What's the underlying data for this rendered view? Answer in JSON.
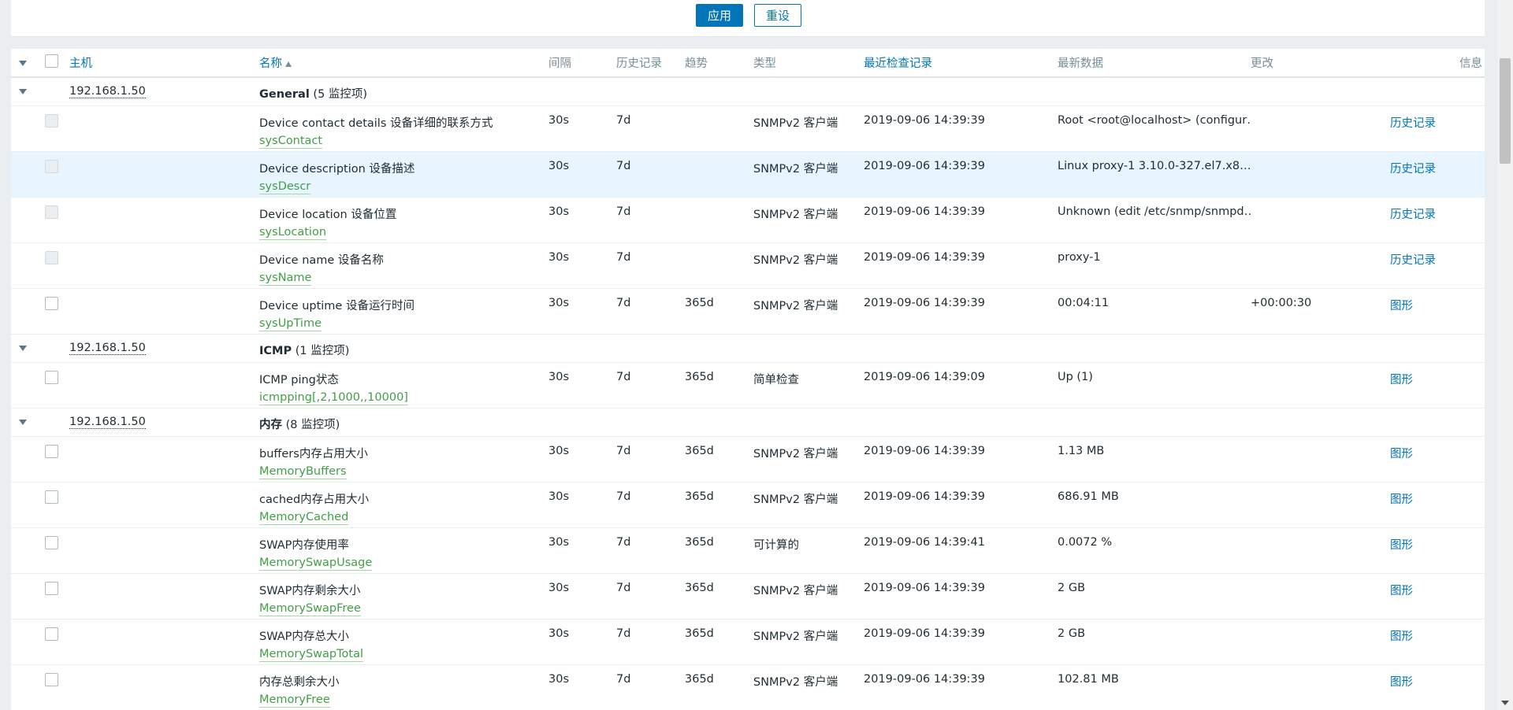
{
  "filter": {
    "apply_label": "应用",
    "reset_label": "重设"
  },
  "table": {
    "headers": {
      "host": "主机",
      "name": "名称",
      "interval": "间隔",
      "history": "历史记录",
      "trends": "趋势",
      "type": "类型",
      "last_check": "最近检查记录",
      "last_value": "最新数据",
      "change": "更改",
      "info": "信息"
    },
    "groups": [
      {
        "host": "192.168.1.50",
        "name": "General",
        "count": "(5 监控项)",
        "items": [
          {
            "name": "Device contact details 设备详细的联系方式",
            "key": "sysContact",
            "interval": "30s",
            "history": "7d",
            "trends": "",
            "type": "SNMPv2 客户端",
            "last_check": "2019-09-06 14:39:39",
            "last_value": "Root <root@localhost> (configur…",
            "change": "",
            "action": "历史记录",
            "disabled": true,
            "highlight": false
          },
          {
            "name": "Device description 设备描述",
            "key": "sysDescr",
            "interval": "30s",
            "history": "7d",
            "trends": "",
            "type": "SNMPv2 客户端",
            "last_check": "2019-09-06 14:39:39",
            "last_value": "Linux proxy-1 3.10.0-327.el7.x8…",
            "change": "",
            "action": "历史记录",
            "disabled": true,
            "highlight": true
          },
          {
            "name": "Device location 设备位置",
            "key": "sysLocation",
            "interval": "30s",
            "history": "7d",
            "trends": "",
            "type": "SNMPv2 客户端",
            "last_check": "2019-09-06 14:39:39",
            "last_value": "Unknown (edit /etc/snmp/snmpd…",
            "change": "",
            "action": "历史记录",
            "disabled": true,
            "highlight": false
          },
          {
            "name": "Device name 设备名称",
            "key": "sysName",
            "interval": "30s",
            "history": "7d",
            "trends": "",
            "type": "SNMPv2 客户端",
            "last_check": "2019-09-06 14:39:39",
            "last_value": "proxy-1",
            "change": "",
            "action": "历史记录",
            "disabled": true,
            "highlight": false
          },
          {
            "name": "Device uptime 设备运行时间",
            "key": "sysUpTime",
            "interval": "30s",
            "history": "7d",
            "trends": "365d",
            "type": "SNMPv2 客户端",
            "last_check": "2019-09-06 14:39:39",
            "last_value": "00:04:11",
            "change": "+00:00:30",
            "action": "图形",
            "disabled": false,
            "highlight": false
          }
        ]
      },
      {
        "host": "192.168.1.50",
        "name": "ICMP",
        "count": "(1 监控项)",
        "items": [
          {
            "name": "ICMP ping状态",
            "key": "icmpping[,2,1000,,10000]",
            "interval": "30s",
            "history": "7d",
            "trends": "365d",
            "type": "简单检查",
            "last_check": "2019-09-06 14:39:09",
            "last_value": "Up (1)",
            "change": "",
            "action": "图形",
            "disabled": false,
            "highlight": false
          }
        ]
      },
      {
        "host": "192.168.1.50",
        "name": "内存",
        "count": "(8 监控项)",
        "items": [
          {
            "name": "buffers内存占用大小",
            "key": "MemoryBuffers",
            "interval": "30s",
            "history": "7d",
            "trends": "365d",
            "type": "SNMPv2 客户端",
            "last_check": "2019-09-06 14:39:39",
            "last_value": "1.13 MB",
            "change": "",
            "action": "图形",
            "disabled": false,
            "highlight": false
          },
          {
            "name": "cached内存占用大小",
            "key": "MemoryCached",
            "interval": "30s",
            "history": "7d",
            "trends": "365d",
            "type": "SNMPv2 客户端",
            "last_check": "2019-09-06 14:39:39",
            "last_value": "686.91 MB",
            "change": "",
            "action": "图形",
            "disabled": false,
            "highlight": false
          },
          {
            "name": "SWAP内存使用率",
            "key": "MemorySwapUsage",
            "interval": "30s",
            "history": "7d",
            "trends": "365d",
            "type": "可计算的",
            "last_check": "2019-09-06 14:39:41",
            "last_value": "0.0072 %",
            "change": "",
            "action": "图形",
            "disabled": false,
            "highlight": false
          },
          {
            "name": "SWAP内存剩余大小",
            "key": "MemorySwapFree",
            "interval": "30s",
            "history": "7d",
            "trends": "365d",
            "type": "SNMPv2 客户端",
            "last_check": "2019-09-06 14:39:39",
            "last_value": "2 GB",
            "change": "",
            "action": "图形",
            "disabled": false,
            "highlight": false
          },
          {
            "name": "SWAP内存总大小",
            "key": "MemorySwapTotal",
            "interval": "30s",
            "history": "7d",
            "trends": "365d",
            "type": "SNMPv2 客户端",
            "last_check": "2019-09-06 14:39:39",
            "last_value": "2 GB",
            "change": "",
            "action": "图形",
            "disabled": false,
            "highlight": false
          },
          {
            "name": "内存总剩余大小",
            "key": "MemoryFree",
            "interval": "30s",
            "history": "7d",
            "trends": "365d",
            "type": "SNMPv2 客户端",
            "last_check": "2019-09-06 14:39:39",
            "last_value": "102.81 MB",
            "change": "",
            "action": "图形",
            "disabled": false,
            "highlight": false
          }
        ]
      }
    ]
  }
}
